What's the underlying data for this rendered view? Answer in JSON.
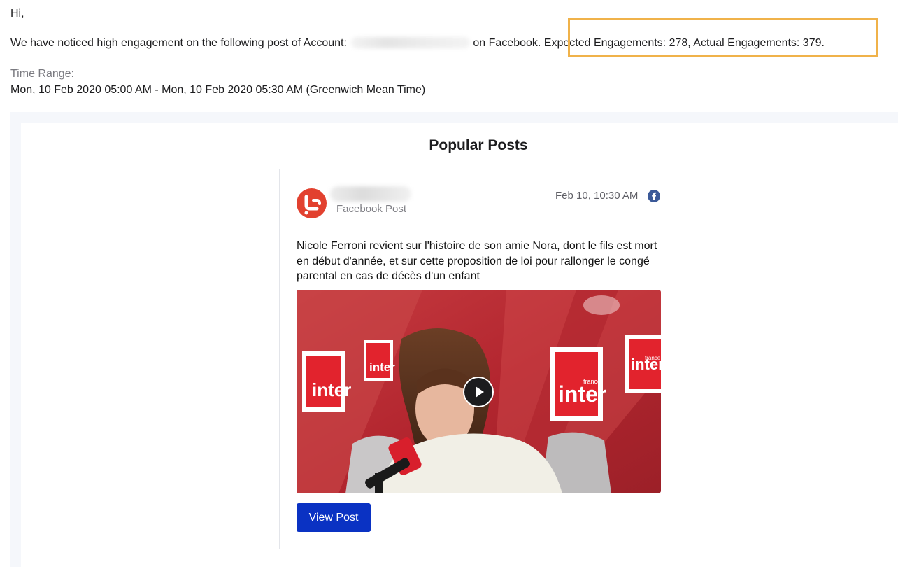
{
  "email": {
    "greeting": "Hi,",
    "notice_prefix": "We have noticed high engagement on the following post of Account:",
    "notice_platform": "on Facebook",
    "notice_engagement": ". Expected Engagements: 278, Actual Engagements: 379.",
    "highlight_color": "#f0b24a",
    "time_range_label": "Time Range:",
    "time_range_value": "Mon, 10 Feb 2020 05:00 AM - Mon, 10 Feb 2020 05:30 AM (Greenwich Mean Time)"
  },
  "popular_posts": {
    "title": "Popular Posts",
    "post": {
      "type": "Facebook Post",
      "date": "Feb 10, 10:30 AM",
      "platform_icon": "facebook-icon",
      "text": "Nicole Ferroni revient sur l'histoire de son amie Nora, dont le fils est mort en début d'année, et sur cette proposition de loi pour rallonger le congé parental en cas de décès d'un enfant",
      "media_logo_text": "inter",
      "media_logo_small": "france",
      "view_button_label": "View Post",
      "button_color": "#0a32c3",
      "avatar_color": "#e2412f"
    }
  }
}
